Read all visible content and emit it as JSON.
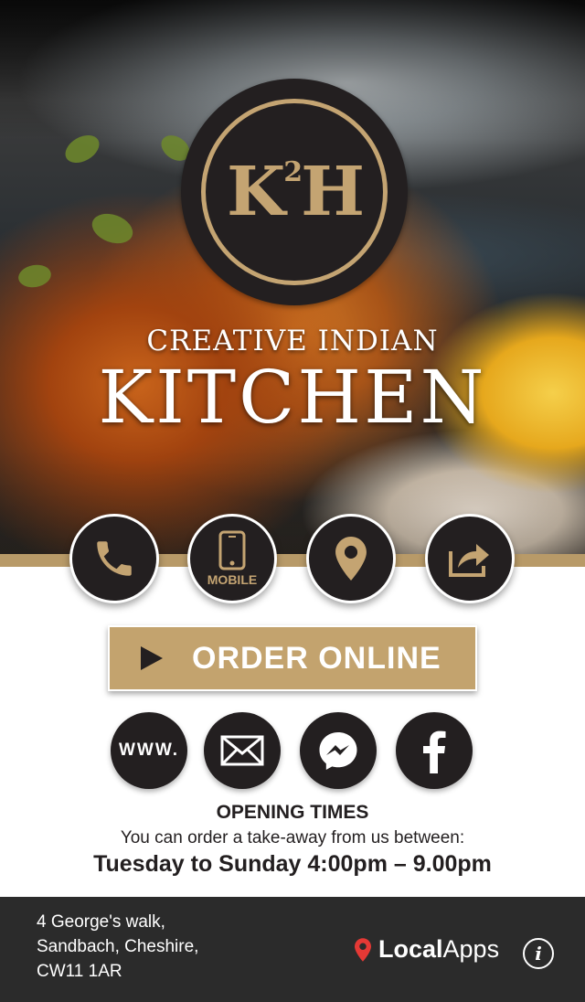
{
  "header": {
    "logo_text": "K2H",
    "tagline": "CREATIVE INDIAN",
    "title": "KITCHEN"
  },
  "actions": {
    "phone_icon": "phone-icon",
    "mobile_label": "MOBILE",
    "location_icon": "map-pin-icon",
    "share_icon": "share-icon"
  },
  "order": {
    "label": "ORDER ONLINE"
  },
  "social": {
    "website_label": "WWW.",
    "email_icon": "envelope-icon",
    "messenger_icon": "messenger-icon",
    "facebook_icon": "facebook-icon"
  },
  "opening": {
    "title": "OPENING TIMES",
    "subtitle": "You can order a take-away from us between:",
    "hours": "Tuesday to Sunday 4:00pm – 9.00pm"
  },
  "footer": {
    "address_line1": "4 George's walk,",
    "address_line2": "Sandbach, Cheshire,",
    "address_line3": "CW11 1AR",
    "brand_bold": "Local",
    "brand_light": "Apps",
    "info_glyph": "i"
  },
  "colors": {
    "gold": "#c3a36e",
    "dark": "#231f20",
    "footer_bg": "#2b2b2b",
    "pin_red": "#e53935"
  }
}
